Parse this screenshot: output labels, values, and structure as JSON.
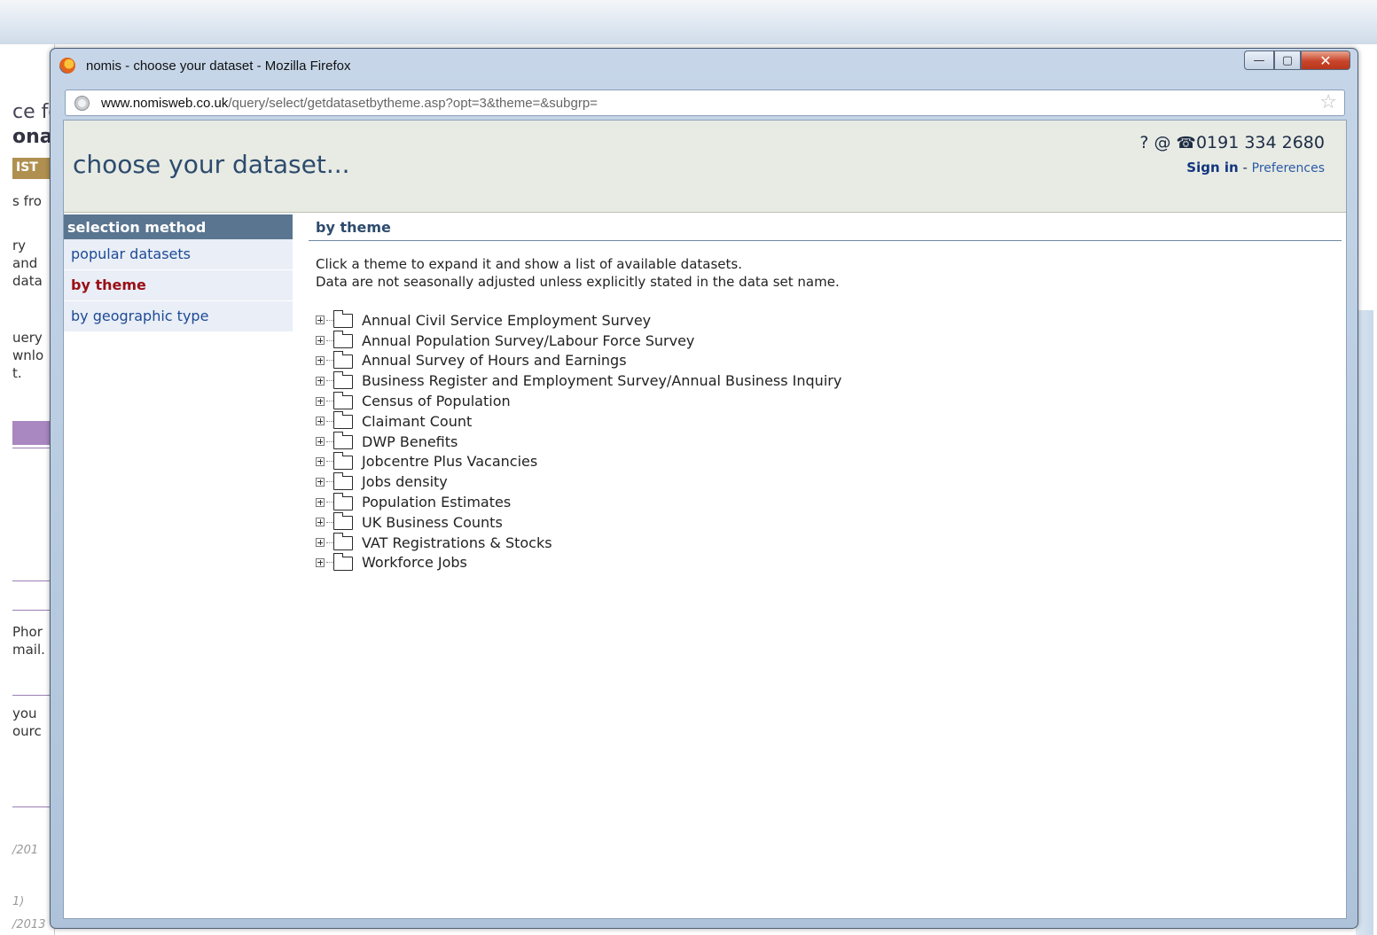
{
  "background": {
    "fragments": [
      "ce fo",
      "ona",
      "IST",
      "s fro",
      "ry",
      "and",
      "data",
      "uery",
      "wnlo",
      "t.",
      "Phor",
      "mail.",
      "you",
      "ourc",
      "/201",
      "1)",
      "/2013"
    ]
  },
  "window": {
    "title": "nomis - choose your dataset - Mozilla Firefox",
    "controls": {
      "minimize": "—",
      "maximize": "▢",
      "close": "✕"
    }
  },
  "address_bar": {
    "url_domain": "www.nomisweb.co.uk",
    "url_path": "/query/select/getdatasetbytheme.asp?opt=3&theme=&subgrp="
  },
  "header": {
    "title": "choose your dataset...",
    "help": "?",
    "at": "@",
    "phone": "0191 334 2680",
    "sign_in": "Sign in",
    "separator": " - ",
    "preferences": "Preferences"
  },
  "sidebar": {
    "heading": "selection method",
    "items": [
      {
        "label": "popular datasets"
      },
      {
        "label": "by theme"
      },
      {
        "label": "by geographic type"
      }
    ]
  },
  "main": {
    "heading": "by theme",
    "intro_line1": "Click a theme to expand it and show a list of available datasets.",
    "intro_line2": "Data are not seasonally adjusted unless explicitly stated in the data set name.",
    "themes": [
      "Annual Civil Service Employment Survey",
      "Annual Population Survey/Labour Force Survey",
      "Annual Survey of Hours and Earnings",
      "Business Register and Employment Survey/Annual Business Inquiry",
      "Census of Population",
      "Claimant Count",
      "DWP Benefits",
      "Jobcentre Plus Vacancies",
      "Jobs density",
      "Population Estimates",
      "UK Business Counts",
      "VAT Registrations & Stocks",
      "Workforce Jobs"
    ]
  }
}
